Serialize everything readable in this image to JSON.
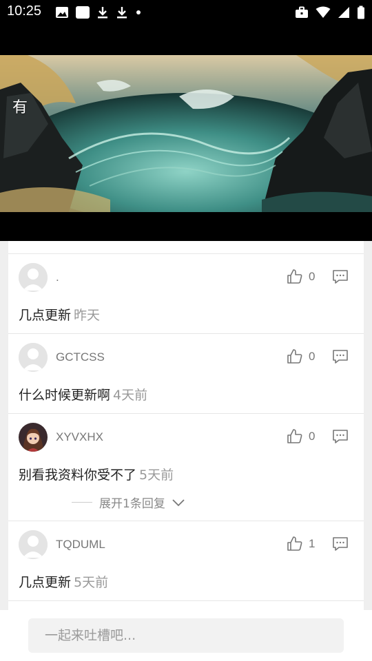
{
  "status_bar": {
    "time": "10:25",
    "left_icons": [
      "image-icon",
      "app-icon",
      "download-icon",
      "download-icon",
      "dot-icon"
    ],
    "right_icons": [
      "briefcase-icon",
      "wifi-icon",
      "signal-icon",
      "battery-icon"
    ]
  },
  "banner": {
    "title": "有"
  },
  "comments": [
    {
      "username": ".",
      "likes": "0",
      "text": "几点更新",
      "time": "昨天",
      "avatar": "default"
    },
    {
      "username": "GCTCSS",
      "likes": "0",
      "text": "什么时候更新啊",
      "time": "4天前",
      "avatar": "default"
    },
    {
      "username": "XYVXHX",
      "likes": "0",
      "text": "别看我资料你受不了",
      "time": "5天前",
      "avatar": "custom",
      "replies_label": "展开1条回复"
    },
    {
      "username": "TQDUML",
      "likes": "1",
      "text": "几点更新",
      "time": "5天前",
      "avatar": "default"
    }
  ],
  "input": {
    "placeholder": "一起来吐槽吧..."
  },
  "colors": {
    "accent_text": "#222222",
    "muted_text": "#999999",
    "banner_sea": "#2f6e66"
  }
}
